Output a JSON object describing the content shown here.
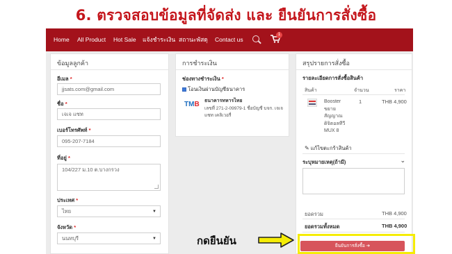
{
  "heading": "6. ตรวจสอบข้อมูลที่จัดส่ง และ ยืนยันการสั่งซื้อ",
  "nav": {
    "items": [
      "Home",
      "All Product",
      "Hot Sale",
      "แจ้งชำระเงิน",
      "สถานะพัสดุ",
      "Contact us"
    ],
    "cart_count": "1"
  },
  "customer": {
    "title": "ข้อมูลลูกค้า",
    "email": {
      "label": "อีเมล",
      "required": "*",
      "value": "jjsats.com@gmail.com"
    },
    "name": {
      "label": "ชื่อ",
      "required": "*",
      "value": "เจเจ แซท"
    },
    "phone": {
      "label": "เบอร์โทรศัพท์",
      "required": "*",
      "value": "095-207-7184"
    },
    "address": {
      "label": "ที่อยู่",
      "required": "*",
      "value": "104/227 ม.10 ต.บางกรวง"
    },
    "country": {
      "label": "ประเทศ",
      "required": "*",
      "value": "ไทย"
    },
    "province": {
      "label": "จังหวัด",
      "required": "*",
      "value": "นนทบุรี"
    }
  },
  "payment": {
    "title": "การชำระเงิน",
    "channel_label": "ช่องทางชำระเงิน",
    "required": "*",
    "option": "โอนเงินผ่านบัญชีธนาคาร",
    "bank_logo": "TMB",
    "bank_name": "ธนาคารทหารไทย",
    "account_line1": "เลขที่ 271-2-09979-1 ชื่อบัญชี บจก. เจเจ",
    "account_line2": "แซท เคลิเวอรี่"
  },
  "summary": {
    "title": "สรุปรายการสั่งซื้อ",
    "detail_title": "รายละเอียดการสั่งซื้อสินค้า",
    "columns": {
      "product": "สินค้า",
      "qty": "จำนวน",
      "price": "ราคา"
    },
    "item": {
      "name_lines": [
        "Booster",
        "ขยาย",
        "สัญญาณ",
        "ดิจิตอลทีวี",
        "MUX 8"
      ],
      "qty": "1",
      "price": "THB 4,900"
    },
    "edit_cart": "แก้ไขตะกร้าสินค้า",
    "note_label": "ระบุหมายเหตุ(ถ้ามี)",
    "subtotal_label": "ยอดรวม",
    "subtotal_value": "THB 4,900",
    "total_label": "ยอดรวมทั้งหมด",
    "total_value": "THB 4,900",
    "confirm_button": "ยืนยันการสั่งซื้อ ➔"
  },
  "callout": {
    "label": "กดยืนยัน"
  },
  "colors": {
    "brand_red": "#a3121b",
    "heading_red": "#c4161c",
    "highlight_yellow": "#f5ec06",
    "button_red": "#d7545b"
  }
}
